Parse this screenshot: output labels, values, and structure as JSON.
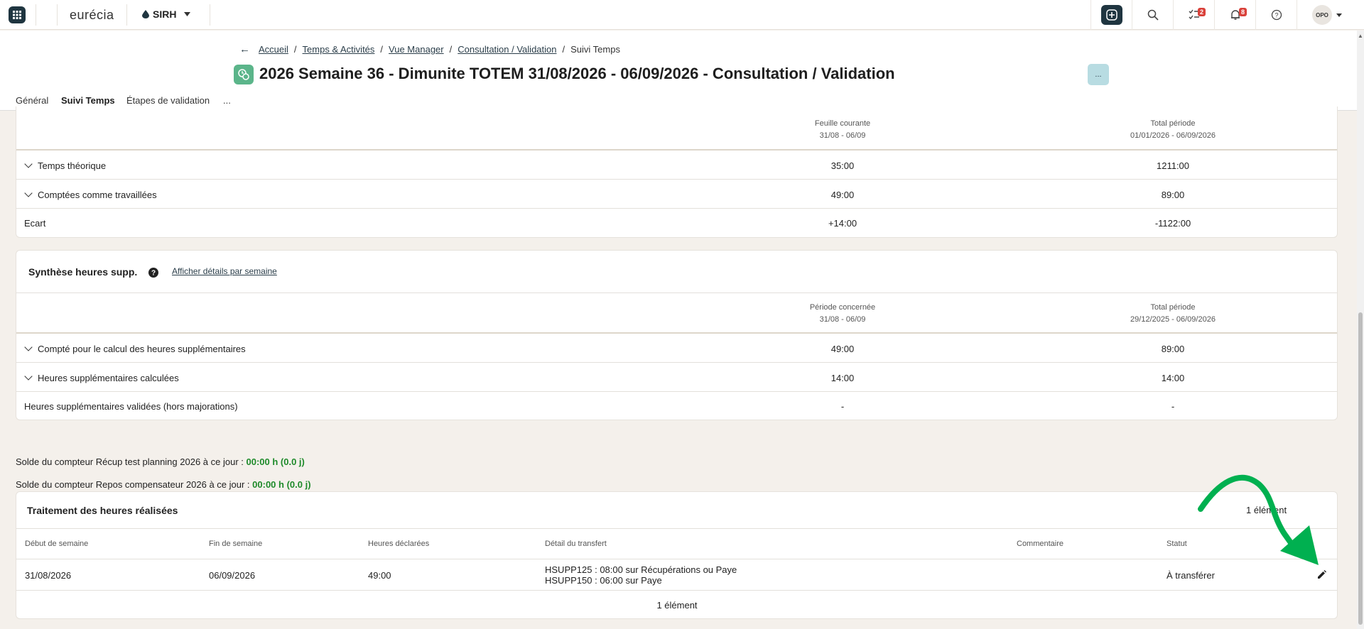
{
  "topbar": {
    "logo": "eurécia",
    "module": "SIRH",
    "badge_tasks": "2",
    "badge_notifications": "8",
    "avatar": "OPO"
  },
  "breadcrumb": [
    "Accueil",
    "Temps & Activités",
    "Vue Manager",
    "Consultation / Validation",
    "Suivi Temps"
  ],
  "page": {
    "title": "2026 Semaine 36 - Dimunite TOTEM 31/08/2026 - 06/09/2026 - Consultation / Validation",
    "more_label": "..."
  },
  "tabs": [
    "Général",
    "Suivi Temps",
    "Étapes de validation",
    "..."
  ],
  "summary": {
    "col1_header": "Feuille courante",
    "col1_sub": "31/08 - 06/09",
    "col2_header": "Total période",
    "col2_sub": "01/01/2026 - 06/09/2026",
    "rows": [
      {
        "label": "Temps théorique",
        "v1": "35:00",
        "v2": "1211:00"
      },
      {
        "label": "Comptées comme travaillées",
        "v1": "49:00",
        "v2": "89:00"
      },
      {
        "label": "Ecart",
        "v1": "+14:00",
        "v2": "-1122:00"
      }
    ]
  },
  "overtime": {
    "title": "Synthèse heures supp.",
    "help_icon": "question-circle-icon",
    "link": "Afficher détails par semaine",
    "col1_header": "Période concernée",
    "col1_sub": "31/08 - 06/09",
    "col2_header": "Total période",
    "col2_sub": "29/12/2025 - 06/09/2026",
    "rows": [
      {
        "label": "Compté pour le calcul des heures supplémentaires",
        "v1": "49:00",
        "v2": "89:00"
      },
      {
        "label": "Heures supplémentaires calculées",
        "v1": "14:00",
        "v2": "14:00"
      },
      {
        "label": "Heures supplémentaires validées (hors majorations)",
        "v1": "-",
        "v2": "-"
      }
    ]
  },
  "balances": [
    {
      "label": "Solde du compteur Récup test planning 2026 à ce jour  : ",
      "value": "00:00 h (0.0 j)"
    },
    {
      "label": "Solde du compteur Repos compensateur 2026 à ce jour  : ",
      "value": "00:00 h (0.0 j)"
    }
  ],
  "processing": {
    "title": "Traitement des heures réalisées",
    "count_top": "1 élément",
    "columns": [
      "Début de semaine",
      "Fin de semaine",
      "Heures déclarées",
      "Détail du transfert",
      "Commentaire",
      "Statut"
    ],
    "row": {
      "start": "31/08/2026",
      "end": "06/09/2026",
      "hours": "49:00",
      "detail_line1": "HSUPP125 : 08:00 sur Récupérations ou Paye",
      "detail_line2": "HSUPP150 : 06:00 sur Paye",
      "comment": "",
      "status": "À transférer"
    },
    "count_bottom": "1 élément"
  },
  "colors": {
    "accent": "#1f3540",
    "annotation_arrow": "#00b050",
    "balance_value": "#1e8a2a"
  }
}
